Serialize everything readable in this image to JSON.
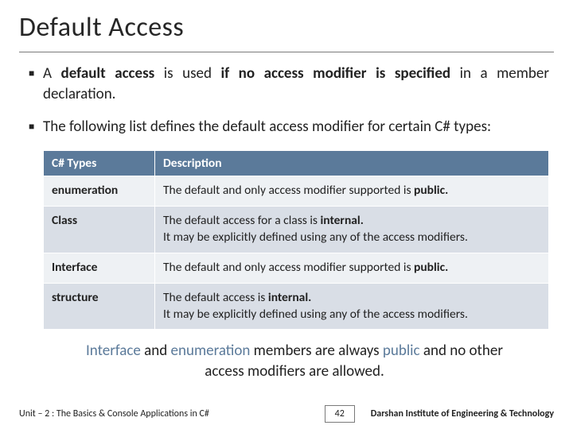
{
  "title": "Default Access",
  "bullets": {
    "b1_pre": "A ",
    "b1_bold1": "default access",
    "b1_mid": " is used ",
    "b1_bold2": "if no access modifier is specified",
    "b1_post": " in a member declaration.",
    "b2": "The following list defines the default access modifier for certain C# types:"
  },
  "table": {
    "head_col1": "C# Types",
    "head_col2": "Description",
    "rows": [
      {
        "type": "enumeration",
        "pre": "The default and only access modifier supported is ",
        "kw": "public.",
        "post": ""
      },
      {
        "type": "Class",
        "pre": "The default access for a class is ",
        "kw": "internal.",
        "post": "It may be explicitly defined using any of the access modifiers."
      },
      {
        "type": "Interface",
        "pre": "The default and only access modifier supported is ",
        "kw": "public.",
        "post": ""
      },
      {
        "type": "structure",
        "pre": "The default access is ",
        "kw": "internal.",
        "post": "It may be explicitly defined using any of the access modifiers."
      }
    ]
  },
  "note": {
    "kw1": "Interface",
    "t1": " and ",
    "kw2": "enumeration",
    "t2": " members are always ",
    "kw3": "public",
    "t3": " and no other access modifiers are allowed."
  },
  "footer": {
    "unit": "Unit – 2 : The Basics & Console Applications in C#",
    "page": "42",
    "institute": "Darshan Institute of Engineering & Technology"
  }
}
